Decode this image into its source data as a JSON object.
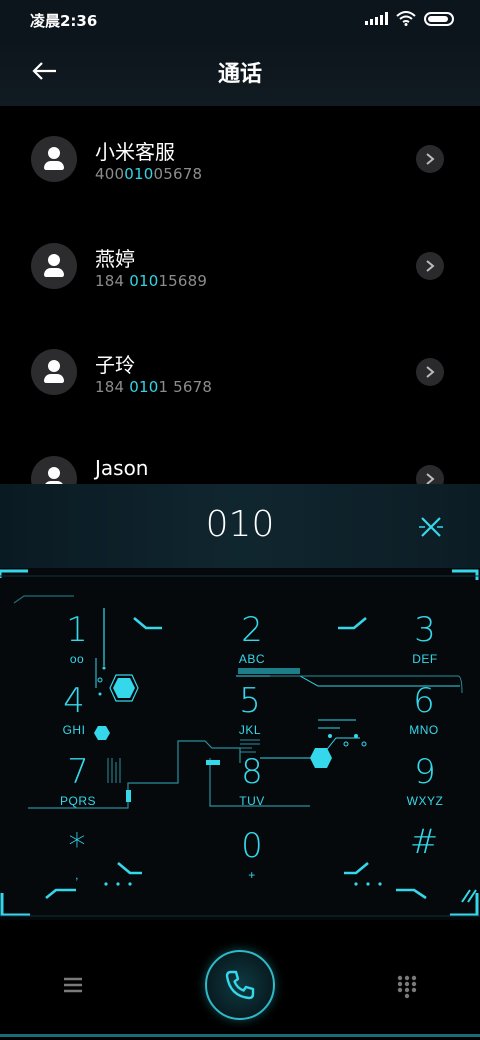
{
  "status_bar": {
    "time": "凌晨2:36",
    "icons": [
      "signal-icon",
      "wifi-icon",
      "battery-icon"
    ]
  },
  "header": {
    "title": "通话",
    "back_icon": "back-arrow-icon"
  },
  "contacts": [
    {
      "name": "小米客服",
      "number_pre": "400",
      "number_match": "010",
      "number_post": "05678"
    },
    {
      "name": "燕婷",
      "number_pre": "184 ",
      "number_match": "010",
      "number_post": "15689"
    },
    {
      "name": "子玲",
      "number_pre": "184 ",
      "number_match": "010",
      "number_post": "1 5678"
    },
    {
      "name": "Jason",
      "number_pre": "",
      "number_match": "",
      "number_post": ""
    }
  ],
  "dialer": {
    "input": "010",
    "clear_icon": "close-icon"
  },
  "keypad": {
    "keys": [
      {
        "digit": "1",
        "letters": "oo"
      },
      {
        "digit": "2",
        "letters": "ABC"
      },
      {
        "digit": "3",
        "letters": "DEF"
      },
      {
        "digit": "4",
        "letters": "GHI"
      },
      {
        "digit": "5",
        "letters": "JKL"
      },
      {
        "digit": "6",
        "letters": "MNO"
      },
      {
        "digit": "7",
        "letters": "PQRS"
      },
      {
        "digit": "8",
        "letters": "TUV"
      },
      {
        "digit": "9",
        "letters": "WXYZ"
      },
      {
        "digit": "*",
        "letters": ","
      },
      {
        "digit": "0",
        "letters": "+"
      },
      {
        "digit": "#",
        "letters": ""
      }
    ]
  },
  "bottom_bar": {
    "menu_icon": "menu-icon",
    "call_icon": "phone-icon",
    "keypad_icon": "dialpad-icon"
  },
  "colors": {
    "accent": "#35d8ea",
    "number_highlight": "#33d5e6",
    "background": "#000000"
  }
}
